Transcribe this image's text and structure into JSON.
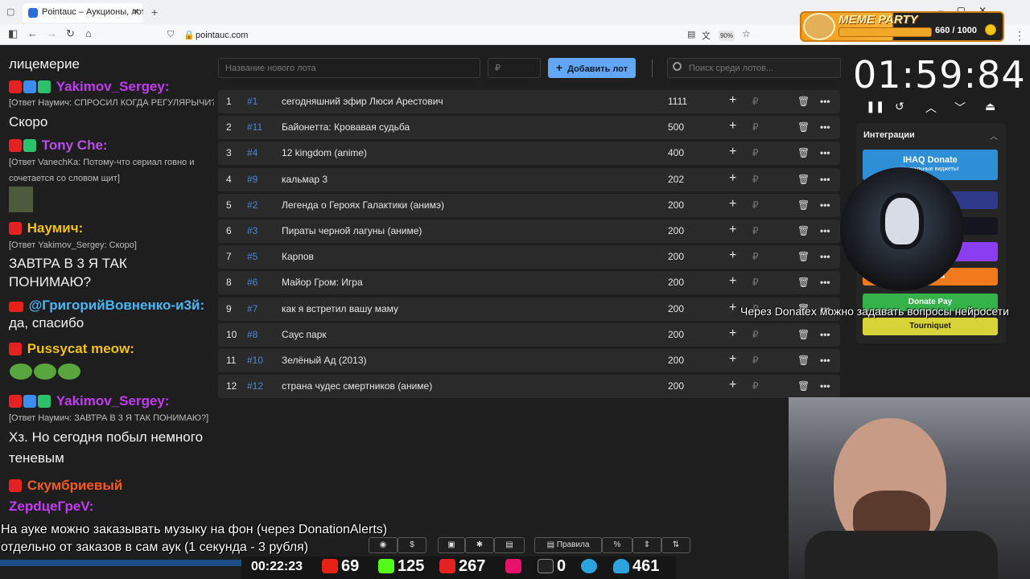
{
  "browser": {
    "tab_title": "Pointauc – Аукционы, лотереи",
    "url": "pointauc.com",
    "zoom": "90%"
  },
  "meme_party": {
    "title": "MEME PARTY",
    "count": "660 / 1000"
  },
  "chat": {
    "messages": [
      {
        "text": "лицемерие",
        "color": "#f2f2f2"
      },
      {
        "name": "Yakimov_Sergey:",
        "color": "#c13cf0"
      },
      {
        "reply": "[Ответ Наумич: СПРОСИЛ КОГДА РЕГУЛЯРЫЧИ?]"
      },
      {
        "text": "Скоро"
      },
      {
        "name": "Tony Che:",
        "color": "#b84de8"
      },
      {
        "reply": "[Ответ VanechKa: Потому-что сериал говно и"
      },
      {
        "reply2": "сочетается со словом щит]"
      },
      {
        "name": "Наумич:",
        "color": "#f2c21b"
      },
      {
        "reply": "[Ответ Yakimov_Sergey: Скоро]"
      },
      {
        "text": "ЗАВТРА В 3 Я ТАК"
      },
      {
        "text2": "ПОНИМАЮ?"
      },
      {
        "name": "@ГригорийВовненко-и3й:",
        "color": "#4ab6f5"
      },
      {
        "text": "да, спасибо"
      },
      {
        "name": "Pussycat meow:",
        "color": "#f2c21b"
      },
      {
        "name": "Yakimov_Sergey:",
        "color": "#c13cf0"
      },
      {
        "reply": "[Ответ Наумич: ЗАВТРА В 3 Я ТАК ПОНИМАЮ?]"
      },
      {
        "text": "Хз. Но сегодня побыл немного"
      },
      {
        "text2": "теневым"
      },
      {
        "name": "Скумбриевый",
        "color": "#f55a23"
      },
      {
        "name": "ZерdцеГреV:",
        "color": "#c13cf0"
      }
    ]
  },
  "form": {
    "lot_name_placeholder": "Название нового лота",
    "amount_placeholder": "₽",
    "add_label": "Добавить лот",
    "search_placeholder": "Поиск среди лотов..."
  },
  "lots": [
    {
      "idx": "1",
      "id": "#1",
      "name": "сегодняшний эфир Люси Арестович",
      "amount": "1111"
    },
    {
      "idx": "2",
      "id": "#11",
      "name": "Байонетта: Кровавая судьба",
      "amount": "500"
    },
    {
      "idx": "3",
      "id": "#4",
      "name": "12 kingdom (anime)",
      "amount": "400"
    },
    {
      "idx": "4",
      "id": "#9",
      "name": "кальмар 3",
      "amount": "202"
    },
    {
      "idx": "5",
      "id": "#2",
      "name": "Легенда о Героях Галактики (анимэ)",
      "amount": "200"
    },
    {
      "idx": "6",
      "id": "#3",
      "name": "Пираты черной лагуны (аниме)",
      "amount": "200"
    },
    {
      "idx": "7",
      "id": "#5",
      "name": "Карпов",
      "amount": "200"
    },
    {
      "idx": "8",
      "id": "#6",
      "name": "Майор Гром: Игра",
      "amount": "200"
    },
    {
      "idx": "9",
      "id": "#7",
      "name": "как я встретил вашу маму",
      "amount": "200"
    },
    {
      "idx": "10",
      "id": "#8",
      "name": "Саус парк",
      "amount": "200"
    },
    {
      "idx": "11",
      "id": "#10",
      "name": "Зелёный Ад (2013)",
      "amount": "200"
    },
    {
      "idx": "12",
      "id": "#12",
      "name": "страна чудес смертников (аниме)",
      "amount": "200"
    }
  ],
  "row_symbols": {
    "plus": "+",
    "rub": "₽",
    "del": "🗑",
    "more": "•••"
  },
  "timer": {
    "value": "01:59:84"
  },
  "integrations": {
    "title": "Интеграции",
    "items": [
      {
        "label": "IHAQ Donate",
        "color": "#2f8fd6"
      },
      {
        "label": "...Alerts",
        "color": "#f07a1c"
      },
      {
        "label": "Donate Pay",
        "color": "#35b24a"
      },
      {
        "label": "Tourniquet",
        "color": "#d9d33a"
      }
    ],
    "ihaq_sub": "Уникальные виджеты!"
  },
  "overlay": {
    "donatex": "Через Donatex можно задавать вопросы нейросети",
    "music_line1": "На ауке можно заказывать музыку на фон (через DonationAlerts)",
    "music_line2": "отдельно от заказов в сам аук (1 секунда - 3 рубля)"
  },
  "toolbar": {
    "rules": "Правила",
    "percent": "%"
  },
  "stats": {
    "time": "00:22:23",
    "youtube": "69",
    "kick": "125",
    "live": "267",
    "rutube": "0",
    "viewers": "461"
  }
}
